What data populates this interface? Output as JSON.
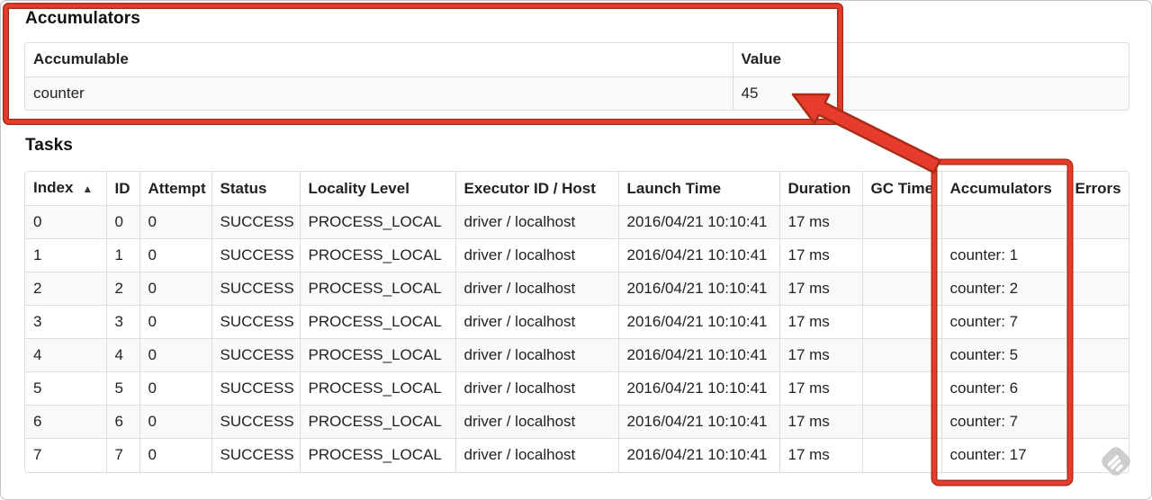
{
  "accumulators_section": {
    "heading": "Accumulators",
    "table": {
      "headers": [
        "Accumulable",
        "Value"
      ],
      "rows": [
        [
          "counter",
          "45"
        ]
      ]
    }
  },
  "tasks_section": {
    "heading": "Tasks",
    "table": {
      "headers": [
        "Index",
        "ID",
        "Attempt",
        "Status",
        "Locality Level",
        "Executor ID / Host",
        "Launch Time",
        "Duration",
        "GC Time",
        "Accumulators",
        "Errors"
      ],
      "sort_indicator": "▲",
      "rows": [
        [
          "0",
          "0",
          "0",
          "SUCCESS",
          "PROCESS_LOCAL",
          "driver / localhost",
          "2016/04/21 10:10:41",
          "17 ms",
          "",
          "",
          ""
        ],
        [
          "1",
          "1",
          "0",
          "SUCCESS",
          "PROCESS_LOCAL",
          "driver / localhost",
          "2016/04/21 10:10:41",
          "17 ms",
          "",
          "counter: 1",
          ""
        ],
        [
          "2",
          "2",
          "0",
          "SUCCESS",
          "PROCESS_LOCAL",
          "driver / localhost",
          "2016/04/21 10:10:41",
          "17 ms",
          "",
          "counter: 2",
          ""
        ],
        [
          "3",
          "3",
          "0",
          "SUCCESS",
          "PROCESS_LOCAL",
          "driver / localhost",
          "2016/04/21 10:10:41",
          "17 ms",
          "",
          "counter: 7",
          ""
        ],
        [
          "4",
          "4",
          "0",
          "SUCCESS",
          "PROCESS_LOCAL",
          "driver / localhost",
          "2016/04/21 10:10:41",
          "17 ms",
          "",
          "counter: 5",
          ""
        ],
        [
          "5",
          "5",
          "0",
          "SUCCESS",
          "PROCESS_LOCAL",
          "driver / localhost",
          "2016/04/21 10:10:41",
          "17 ms",
          "",
          "counter: 6",
          ""
        ],
        [
          "6",
          "6",
          "0",
          "SUCCESS",
          "PROCESS_LOCAL",
          "driver / localhost",
          "2016/04/21 10:10:41",
          "17 ms",
          "",
          "counter: 7",
          ""
        ],
        [
          "7",
          "7",
          "0",
          "SUCCESS",
          "PROCESS_LOCAL",
          "driver / localhost",
          "2016/04/21 10:10:41",
          "17 ms",
          "",
          "counter: 17",
          ""
        ]
      ]
    }
  },
  "annotations": {
    "red": "#e73c2d",
    "red_dark": "#a92c17",
    "table_border": "#dddddd",
    "stripe_bg": "#f9f9f9"
  }
}
